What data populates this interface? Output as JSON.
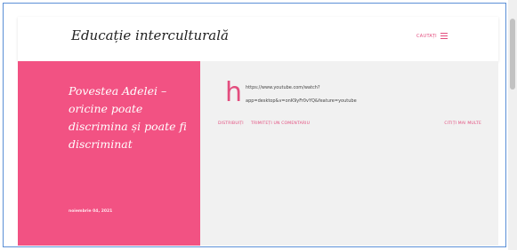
{
  "header": {
    "site_title": "Educație interculturală",
    "search_label": "CAUTAȚI",
    "menu_icon": "hamburger-menu-icon"
  },
  "post": {
    "title": "Povestea Adelei – oricine poate discrimina și poate fi discriminat",
    "date": "noiembrie 04, 2021",
    "avatar_letter": "h",
    "url_line1": "https://www.youtube.com/watch?",
    "url_line2": "app=desktop&v=onK9yFr0vYQ&feature=youtube",
    "share_label": "DISTRIBUIȚI",
    "report_label": "TRIMITEȚI UN COMENTARIU",
    "read_more_label": "CITIȚI MAI MULTE"
  },
  "colors": {
    "accent": "#e34d7e",
    "hero_bg": "#f25283",
    "content_bg": "#f1f1f1",
    "frame_border": "#5b8fd6"
  }
}
